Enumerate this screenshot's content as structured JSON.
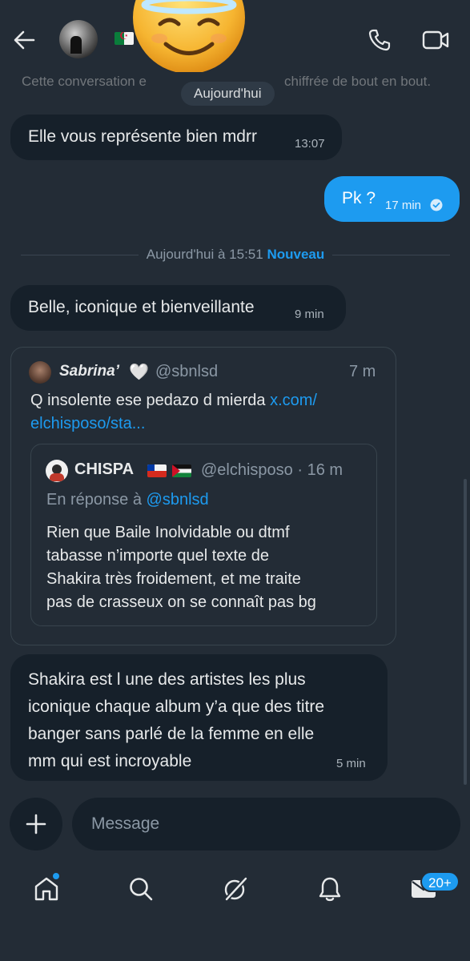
{
  "header": {
    "back_icon": "arrow-left-icon",
    "call_icon": "phone-icon",
    "video_icon": "video-camera-icon"
  },
  "encryption_notice": "Cette conversation e... chiffrée de bout en bout.",
  "encryption_left": "Cette conversation e",
  "encryption_right": "chiffrée de bout en bout.",
  "today_label": "Aujourd'hui",
  "messages": [
    {
      "text": "Elle vous représente bien mdrr",
      "time": "13:07"
    },
    {
      "text": "Pk ?",
      "time": "17 min"
    },
    {
      "text": "Belle, iconique et bienveillante",
      "time": "9 min"
    },
    {
      "line1": "Shakira est l une des artistes les plus",
      "line2": "iconique chaque album y’a que des titre",
      "line3": "banger sans parlé de la femme en elle",
      "line4": "mm qui est incroyable",
      "time": "5 min"
    }
  ],
  "divider": {
    "label": "Aujourd'hui à 15:51",
    "new_label": "Nouveau"
  },
  "tweet": {
    "name": "Sabrina’",
    "heart": "🤍",
    "handle": "@sbnlsd",
    "age": "7 m",
    "text": "Q insolente ese pedazo d mierda",
    "link_part1": "x.com/",
    "link_part2": "elchisposo/sta..."
  },
  "quoted": {
    "name": "CHISPA",
    "handle": "@elchisposo · 16 m",
    "reply_prefix": "En réponse à",
    "reply_handle": "@sbnlsd",
    "line1": "Rien que Baile Inolvidable ou dtmf",
    "line2": "tabasse n’importe quel texte de",
    "line3": "Shakira très froidement, et me traite",
    "line4": "pas de crasseux on se connaît pas bg"
  },
  "composer": {
    "placeholder": "Message",
    "plus_icon": "plus-icon"
  },
  "tabbar": {
    "icons": [
      "home-icon",
      "search-icon",
      "grok-icon",
      "bell-icon",
      "envelope-icon"
    ],
    "badge": "20+"
  },
  "colors": {
    "background": "#232c36",
    "bubble_in": "#16202a",
    "bubble_out": "#1d9bf0",
    "accent": "#1d9bf0"
  }
}
